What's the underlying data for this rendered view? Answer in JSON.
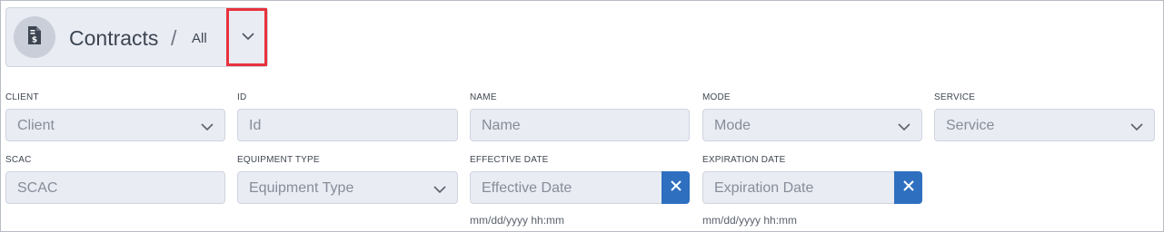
{
  "header": {
    "title": "Contracts",
    "separator": "/",
    "view": "All",
    "icon": "dollar-document-icon",
    "toggle_icon": "chevron-down-icon"
  },
  "filters": {
    "client": {
      "label": "CLIENT",
      "placeholder": "Client"
    },
    "id": {
      "label": "ID",
      "placeholder": "Id"
    },
    "name": {
      "label": "NAME",
      "placeholder": "Name"
    },
    "mode": {
      "label": "MODE",
      "placeholder": "Mode"
    },
    "service": {
      "label": "SERVICE",
      "placeholder": "Service"
    },
    "scac": {
      "label": "SCAC",
      "placeholder": "SCAC"
    },
    "equipment_type": {
      "label": "EQUIPMENT TYPE",
      "placeholder": "Equipment Type"
    },
    "effective_date": {
      "label": "EFFECTIVE DATE",
      "placeholder": "Effective Date",
      "hint": "mm/dd/yyyy hh:mm"
    },
    "expiration_date": {
      "label": "EXPIRATION DATE",
      "placeholder": "Expiration Date",
      "hint": "mm/dd/yyyy hh:mm"
    }
  },
  "colors": {
    "accent": "#2f6fbf",
    "highlight": "#e8323c",
    "field_bg": "#e9ecf3"
  }
}
